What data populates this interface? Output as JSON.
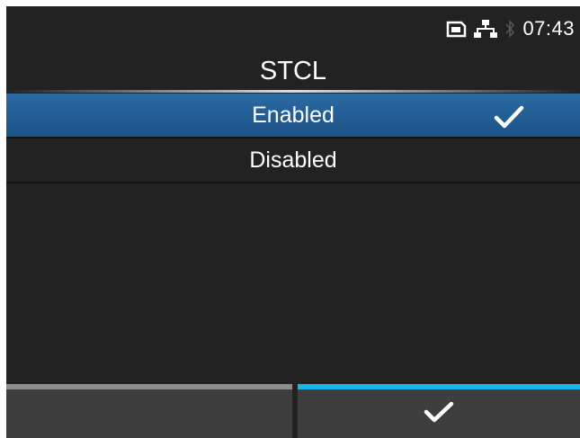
{
  "status_bar": {
    "time": "07:43",
    "icons": [
      "sd-card-icon",
      "network-icon",
      "bluetooth-icon"
    ]
  },
  "screen": {
    "title": "STCL"
  },
  "options": [
    {
      "label": "Enabled",
      "selected": true
    },
    {
      "label": "Disabled",
      "selected": false
    }
  ],
  "footer": {
    "left_button_icon": "",
    "right_button_icon": "checkmark-icon"
  },
  "colors": {
    "background": "#222222",
    "selection": "#1f5a93",
    "accent": "#19b6ea",
    "inactive_bar": "#8c8c8c"
  }
}
